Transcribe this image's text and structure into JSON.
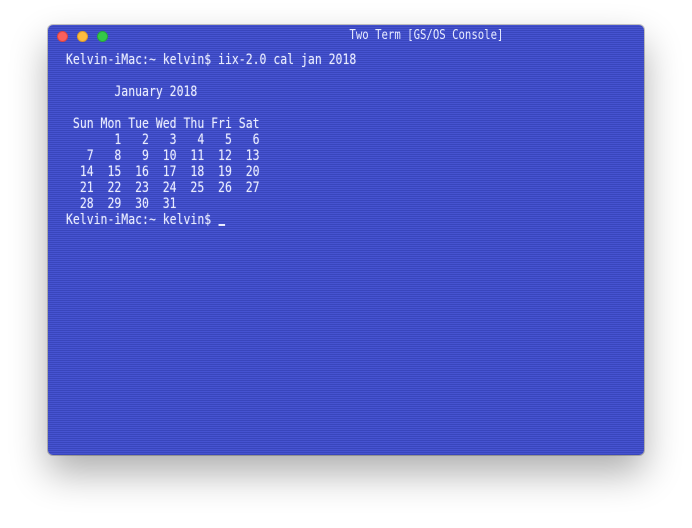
{
  "window": {
    "title": "Two Term [GS/OS Console]"
  },
  "terminal": {
    "lines": [
      "Kelvin-iMac:~ kelvin$ iix-2.0 cal jan 2018",
      "",
      "       January 2018",
      "",
      " Sun Mon Tue Wed Thu Fri Sat",
      "       1   2   3   4   5   6",
      "   7   8   9  10  11  12  13",
      "  14  15  16  17  18  19  20",
      "  21  22  23  24  25  26  27",
      "  28  29  30  31"
    ],
    "prompt": "Kelvin-iMac:~ kelvin$ "
  }
}
